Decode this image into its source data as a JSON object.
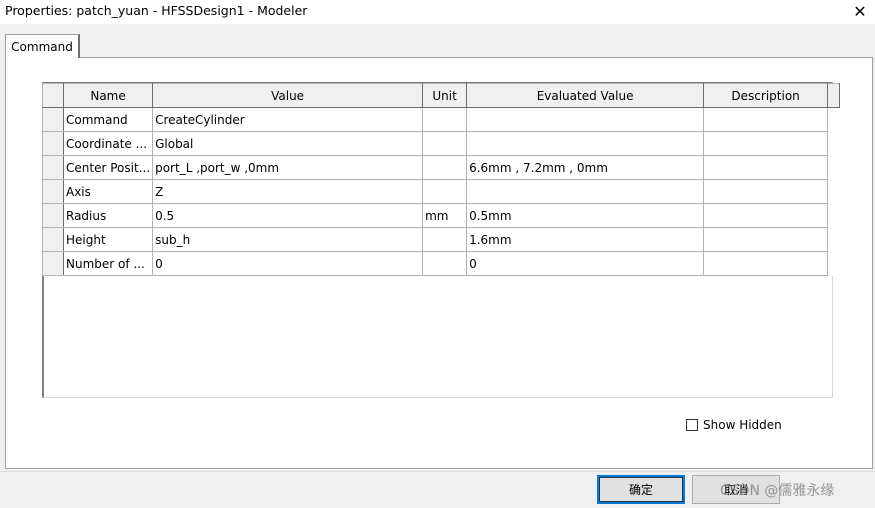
{
  "window": {
    "title": "Properties: patch_yuan - HFSSDesign1 - Modeler",
    "close_glyph": "✕"
  },
  "tabs": [
    {
      "label": "Command"
    }
  ],
  "table": {
    "columns": [
      "Name",
      "Value",
      "Unit",
      "Evaluated Value",
      "Description"
    ],
    "rows": [
      {
        "name": "Command",
        "value": "CreateCylinder",
        "unit": "",
        "evaluated": "",
        "description": ""
      },
      {
        "name": "Coordinate ...",
        "value": "Global",
        "unit": "",
        "evaluated": "",
        "description": ""
      },
      {
        "name": "Center Posit...",
        "value": "port_L ,port_w ,0mm",
        "unit": "",
        "evaluated": "6.6mm , 7.2mm , 0mm",
        "description": ""
      },
      {
        "name": "Axis",
        "value": "Z",
        "unit": "",
        "evaluated": "",
        "description": ""
      },
      {
        "name": "Radius",
        "value": "0.5",
        "unit": "mm",
        "evaluated": "0.5mm",
        "description": ""
      },
      {
        "name": "Height",
        "value": "sub_h",
        "unit": "",
        "evaluated": "1.6mm",
        "description": ""
      },
      {
        "name": "Number of ...",
        "value": "0",
        "unit": "",
        "evaluated": "0",
        "description": ""
      }
    ]
  },
  "show_hidden": {
    "label": "Show Hidden",
    "checked": false
  },
  "buttons": {
    "ok": "确定",
    "cancel": "取消"
  },
  "watermark": "CSDN @儒雅永缘",
  "colors": {
    "focus_border": "#0078d7",
    "background": "#f0f0f0"
  }
}
